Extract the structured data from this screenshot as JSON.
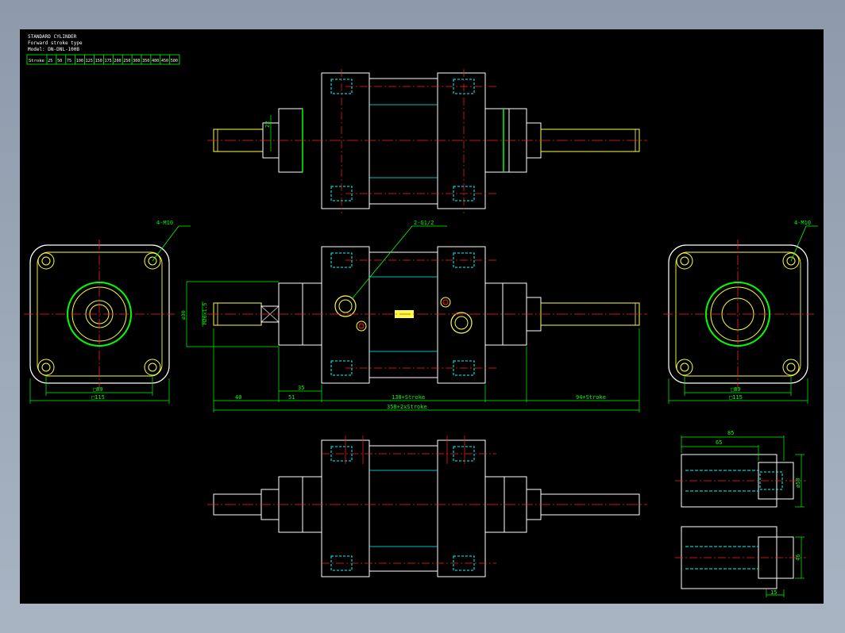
{
  "title_block": {
    "line1": "STANDARD CYLINDER",
    "line2": "Forward stroke type",
    "line3": "Model: DN-DNL-100B",
    "stroke_header": "Stroke",
    "strokes": [
      "25",
      "50",
      "75",
      "100",
      "125",
      "150",
      "175",
      "200",
      "250",
      "300",
      "350",
      "400",
      "450",
      "500"
    ]
  },
  "labels": {
    "port": "2-G1/2",
    "thread_left": "4-M10",
    "thread_right": "4-M10",
    "sq89_left": "□89",
    "sq115_left": "□115",
    "sq89_right": "□89",
    "sq115_right": "□115",
    "dim_40": "40",
    "dim_51": "51",
    "dim_35": "35",
    "dim_138": "138+Stroke",
    "dim_94": "94+Stroke",
    "dim_358": "358+2xStroke",
    "dim_22": "22",
    "phi_30": "ø30",
    "thread_rod": "M20x1.5",
    "dim_85": "85",
    "dim_65": "65",
    "dim_50": "ø50",
    "dim_46": "46",
    "dim_15": "15"
  },
  "colors": {
    "white": "#ffffff",
    "red": "#ff2020",
    "green": "#00ff00",
    "yellow": "#ffff40",
    "cyan": "#00ffff"
  }
}
